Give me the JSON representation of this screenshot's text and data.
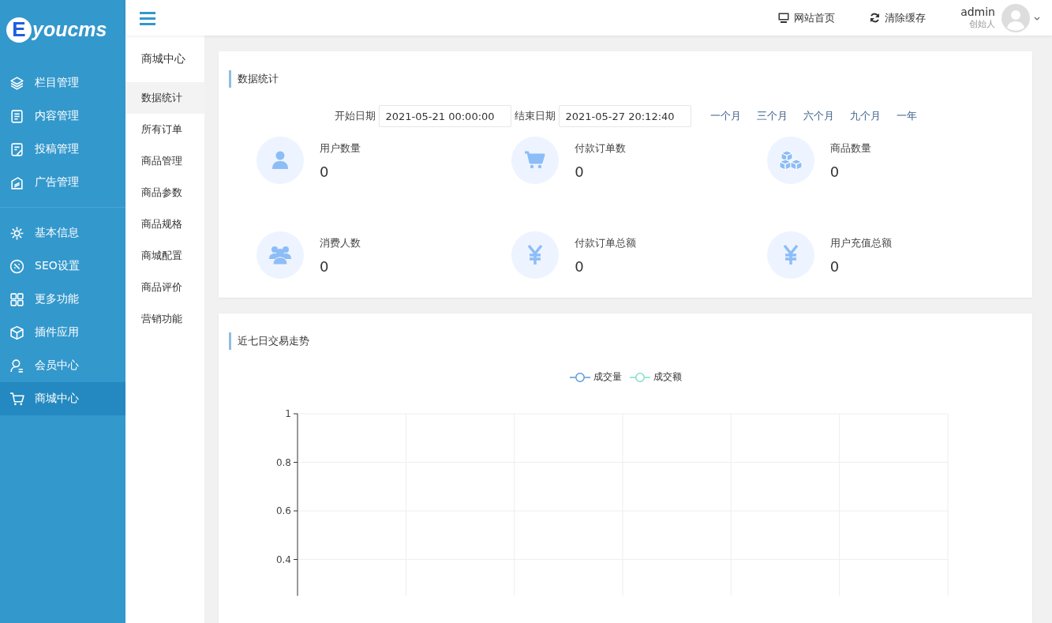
{
  "logo": {
    "text": "youcms",
    "letter": "E"
  },
  "sidebar": {
    "groups": [
      {
        "items": [
          {
            "label": "栏目管理",
            "selected": false
          },
          {
            "label": "内容管理",
            "selected": false
          },
          {
            "label": "投稿管理",
            "selected": false
          },
          {
            "label": "广告管理",
            "selected": false
          }
        ]
      },
      {
        "items": [
          {
            "label": "基本信息",
            "selected": false
          },
          {
            "label": "SEO设置",
            "selected": false
          },
          {
            "label": "更多功能",
            "selected": false
          },
          {
            "label": "插件应用",
            "selected": false
          },
          {
            "label": "会员中心",
            "selected": false
          },
          {
            "label": "商城中心",
            "selected": true
          }
        ]
      }
    ]
  },
  "topbar": {
    "links": [
      "网站首页",
      "清除缓存"
    ],
    "user": {
      "name": "admin",
      "role": "创始人"
    }
  },
  "submenu": {
    "title": "商城中心",
    "items": [
      {
        "label": "数据统计",
        "selected": true
      },
      {
        "label": "所有订单",
        "selected": false
      },
      {
        "label": "商品管理",
        "selected": false
      },
      {
        "label": "商品参数",
        "selected": false
      },
      {
        "label": "商品规格",
        "selected": false
      },
      {
        "label": "商城配置",
        "selected": false
      },
      {
        "label": "商品评价",
        "selected": false
      },
      {
        "label": "营销功能",
        "selected": false
      }
    ]
  },
  "stats_card": {
    "title": "数据统计",
    "start_label": "开始日期",
    "start_value": "2021-05-21 00:00:00",
    "end_label": "结束日期",
    "end_value": "2021-05-27 20:12:40",
    "ranges": [
      "一个月",
      "三个月",
      "六个月",
      "九个月",
      "一年"
    ],
    "stats": [
      {
        "label": "用户数量",
        "value": "0"
      },
      {
        "label": "付款订单数",
        "value": "0"
      },
      {
        "label": "商品数量",
        "value": "0"
      },
      {
        "label": "消费人数",
        "value": "0"
      },
      {
        "label": "付款订单总额",
        "value": "0"
      },
      {
        "label": "用户充值总额",
        "value": "0"
      }
    ]
  },
  "trend_card": {
    "title": "近七日交易走势",
    "chart_data": {
      "type": "line",
      "ylim": [
        0.25,
        1
      ],
      "grid": true,
      "yticks": [
        0.4,
        0.6,
        0.8,
        1
      ],
      "series": [
        {
          "name": "成交量",
          "color": "#5b9bd5"
        },
        {
          "name": "成交额",
          "color": "#7fe0c8"
        }
      ]
    }
  }
}
